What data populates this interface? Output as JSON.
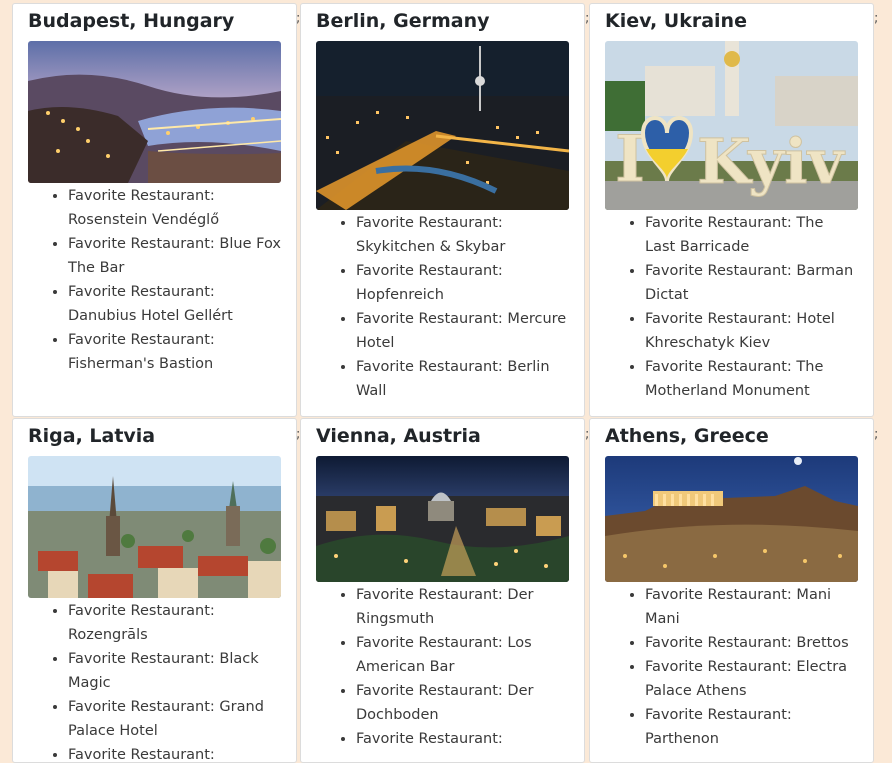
{
  "cities": [
    {
      "name": "Budapest, Hungary",
      "image": "budapest-night-photo",
      "restaurants": [
        "Favorite Restaurant: Rosenstein Vendéglő",
        "Favorite Restaurant: Blue Fox The Bar",
        "Favorite Restaurant: Danubius Hotel Gellért",
        "Favorite Restaurant: Fisherman's Bastion"
      ]
    },
    {
      "name": "Berlin, Germany",
      "image": "berlin-night-photo",
      "restaurants": [
        "Favorite Restaurant: Skykitchen & Skybar",
        "Favorite Restaurant: Hopfenreich",
        "Favorite Restaurant: Mercure Hotel",
        "Favorite Restaurant: Berlin Wall"
      ]
    },
    {
      "name": "Kiev, Ukraine",
      "image": "kyiv-sign-photo",
      "image_text": "I ♥ Kyiv",
      "restaurants": [
        "Favorite Restaurant: The Last Barricade",
        "Favorite Restaurant: Barman Dictat",
        "Favorite Restaurant: Hotel Khreschatyk Kiev",
        "Favorite Restaurant: The Motherland Monument"
      ]
    },
    {
      "name": "Riga, Latvia",
      "image": "riga-skyline-photo",
      "restaurants": [
        "Favorite Restaurant: Rozengrāls",
        "Favorite Restaurant: Black Magic",
        "Favorite Restaurant: Grand Palace Hotel",
        "Favorite Restaurant: Vakarbulli"
      ]
    },
    {
      "name": "Vienna, Austria",
      "image": "vienna-night-photo",
      "restaurants": [
        "Favorite Restaurant: Der Ringsmuth",
        "Favorite Restaurant: Los American Bar",
        "Favorite Restaurant: Der Dochboden",
        "Favorite Restaurant:"
      ]
    },
    {
      "name": "Athens, Greece",
      "image": "athens-acropolis-photo",
      "restaurants": [
        "Favorite Restaurant: Mani Mani",
        "Favorite Restaurant: Brettos",
        "Favorite Restaurant: Electra Palace Athens",
        "Favorite Restaurant: Parthenon"
      ]
    }
  ],
  "separator": ";"
}
